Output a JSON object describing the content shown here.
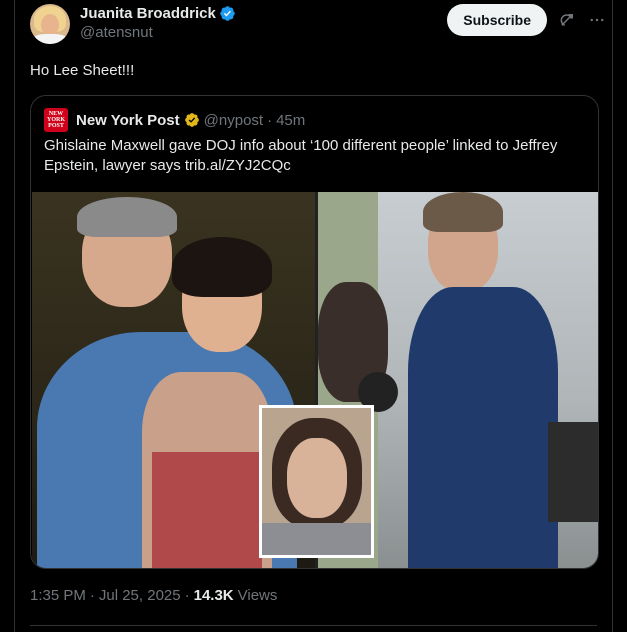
{
  "author": {
    "display_name": "Juanita Broaddrick",
    "handle": "@atensnut",
    "verified_color": "#1d9bf0"
  },
  "actions": {
    "subscribe_label": "Subscribe",
    "grok_icon": "grok-icon",
    "more_icon": "more-icon"
  },
  "tweet": {
    "text": "Ho Lee Sheet!!!",
    "time": "1:35 PM",
    "sep1": "·",
    "date": "Jul 25, 2025",
    "sep2": "·",
    "views_count": "14.3K",
    "views_label": "Views"
  },
  "quoted": {
    "logo_text": "NEW YORK POST",
    "logo_color": "#d0021b",
    "name": "New York Post",
    "badge_color": "#e2b719",
    "handle": "@nypost",
    "sep": "·",
    "time": "45m",
    "text": "Ghislaine Maxwell gave DOJ info about ‘100 different people’ linked to Jeffrey Epstein, lawyer says trib.al/ZYJ2CQc"
  }
}
